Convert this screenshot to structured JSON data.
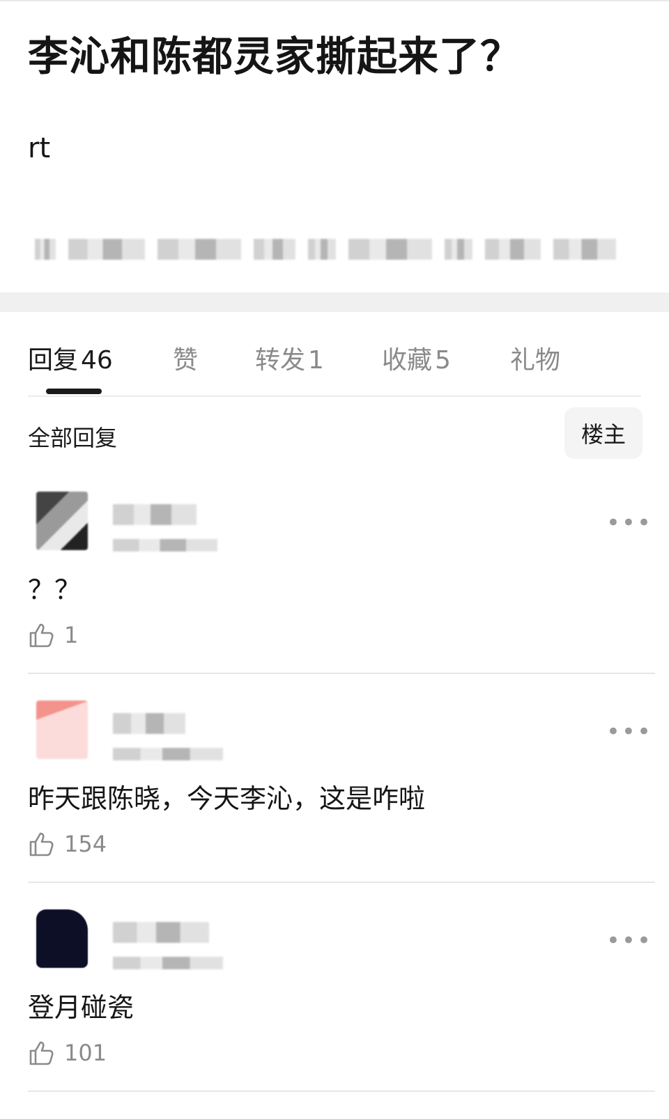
{
  "post": {
    "title": "李沁和陈都灵家撕起来了？",
    "body": "rt"
  },
  "tabs": [
    {
      "label": "回复",
      "count": "46",
      "active": true
    },
    {
      "label": "赞",
      "count": ""
    },
    {
      "label": "转发",
      "count": "1"
    },
    {
      "label": "收藏",
      "count": "5"
    },
    {
      "label": "礼物",
      "count": ""
    }
  ],
  "replies_header": {
    "filter_label": "全部回复",
    "op_only_button": "楼主"
  },
  "replies": [
    {
      "text": "？？",
      "likes": "1",
      "avatar_color": "#5c5c5c"
    },
    {
      "text": "昨天跟陈晓，今天李沁，这是咋啦",
      "likes": "154",
      "avatar_color": "#f6c6c2"
    },
    {
      "text": "登月碰瓷",
      "likes": "101",
      "avatar_color": "#0f1435"
    }
  ],
  "icons": {
    "like": "thumbs-up-icon",
    "more": "more-dots-icon"
  }
}
